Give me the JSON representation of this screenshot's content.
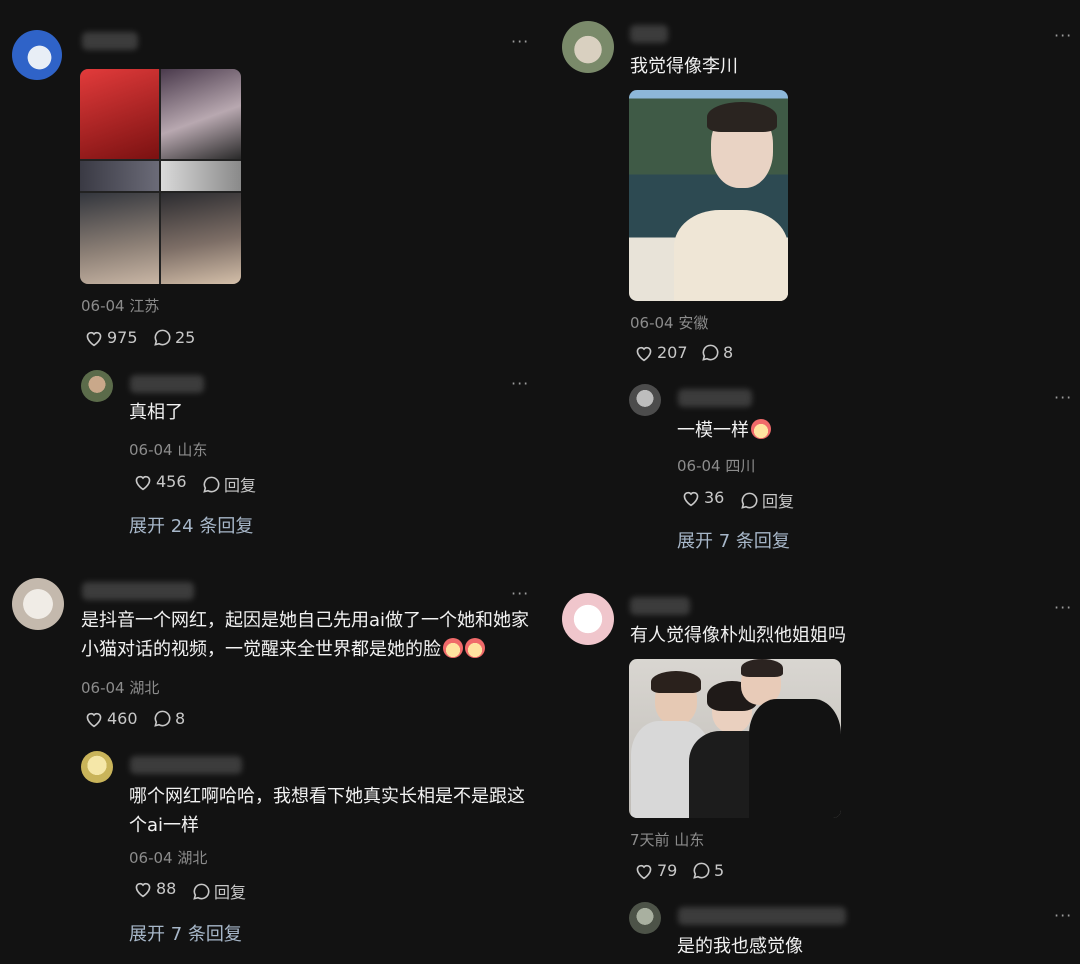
{
  "left": {
    "c1": {
      "date": "06-04 江苏",
      "likes": "975",
      "comments": "25",
      "reply": {
        "text": "真相了",
        "date": "06-04 山东",
        "likes": "456",
        "reply_label": "回复",
        "expand": "展开 24 条回复"
      }
    },
    "c2": {
      "text": "是抖音一个网红，起因是她自己先用ai做了一个她和她家小猫对话的视频，一觉醒来全世界都是她的脸",
      "date": "06-04 湖北",
      "likes": "460",
      "comments": "8",
      "reply": {
        "text": "哪个网红啊哈哈，我想看下她真实长相是不是跟这个ai一样",
        "date": "06-04 湖北",
        "likes": "88",
        "reply_label": "回复",
        "expand": "展开 7 条回复"
      }
    }
  },
  "right": {
    "c1": {
      "text": "我觉得像李川",
      "date": "06-04 安徽",
      "likes": "207",
      "comments": "8",
      "reply": {
        "text": "一模一样",
        "date": "06-04 四川",
        "likes": "36",
        "reply_label": "回复",
        "expand": "展开 7 条回复"
      }
    },
    "c2": {
      "text": "有人觉得像朴灿烈他姐姐吗",
      "date": "7天前 山东",
      "likes": "79",
      "comments": "5",
      "reply": {
        "text": "是的我也感觉像"
      }
    }
  },
  "more_glyph": "···",
  "icons": {
    "like": "heart-icon",
    "comment": "comment-bubble-icon",
    "more": "more-dots-icon",
    "emoji": "clown-emoji"
  }
}
